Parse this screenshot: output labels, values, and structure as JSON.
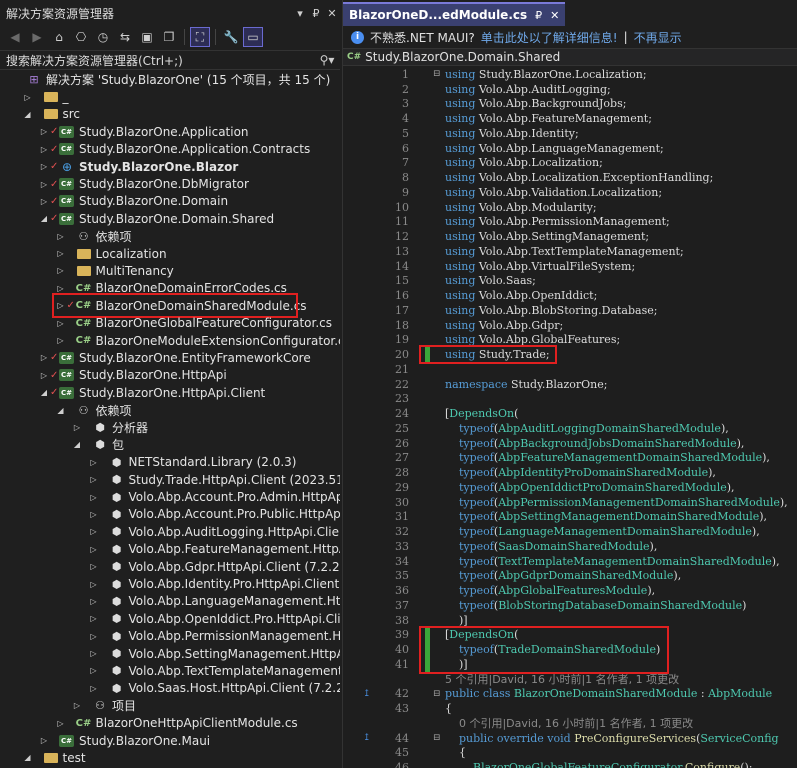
{
  "solution_explorer": {
    "title": "解决方案资源管理器",
    "title_controls": [
      "▾",
      "₽",
      "✕"
    ],
    "search_placeholder": "搜索解决方案资源管理器(Ctrl+;)",
    "tree": [
      {
        "label": "解决方案 'Study.BlazorOne' (15 个项目，共 15 个)",
        "icon": "sln",
        "indent": 0,
        "arrow": "",
        "check": false
      },
      {
        "label": "_",
        "icon": "folder",
        "indent": 1,
        "arrow": "▷",
        "check": false
      },
      {
        "label": "src",
        "icon": "folder",
        "indent": 1,
        "arrow": "◢",
        "check": false
      },
      {
        "label": "Study.BlazorOne.Application",
        "icon": "csproj",
        "indent": 2,
        "arrow": "▷",
        "check": true
      },
      {
        "label": "Study.BlazorOne.Application.Contracts",
        "icon": "csproj",
        "indent": 2,
        "arrow": "▷",
        "check": true
      },
      {
        "label": "Study.BlazorOne.Blazor",
        "icon": "web",
        "indent": 2,
        "arrow": "▷",
        "check": true,
        "bold": true
      },
      {
        "label": "Study.BlazorOne.DbMigrator",
        "icon": "csproj",
        "indent": 2,
        "arrow": "▷",
        "check": true
      },
      {
        "label": "Study.BlazorOne.Domain",
        "icon": "csproj",
        "indent": 2,
        "arrow": "▷",
        "check": true
      },
      {
        "label": "Study.BlazorOne.Domain.Shared",
        "icon": "csproj",
        "indent": 2,
        "arrow": "◢",
        "check": true
      },
      {
        "label": "依赖项",
        "icon": "deps",
        "indent": 3,
        "arrow": "▷",
        "check": false
      },
      {
        "label": "Localization",
        "icon": "folder",
        "indent": 3,
        "arrow": "▷",
        "check": false
      },
      {
        "label": "MultiTenancy",
        "icon": "folder",
        "indent": 3,
        "arrow": "▷",
        "check": false
      },
      {
        "label": "BlazorOneDomainErrorCodes.cs",
        "icon": "cs",
        "indent": 3,
        "arrow": "▷",
        "check": false
      },
      {
        "label": "BlazorOneDomainSharedModule.cs",
        "icon": "cs",
        "indent": 3,
        "arrow": "▷",
        "check": true,
        "highlight": true
      },
      {
        "label": "BlazorOneGlobalFeatureConfigurator.cs",
        "icon": "cs",
        "indent": 3,
        "arrow": "▷",
        "check": false
      },
      {
        "label": "BlazorOneModuleExtensionConfigurator.cs",
        "icon": "cs",
        "indent": 3,
        "arrow": "▷",
        "check": false
      },
      {
        "label": "Study.BlazorOne.EntityFrameworkCore",
        "icon": "csproj",
        "indent": 2,
        "arrow": "▷",
        "check": true
      },
      {
        "label": "Study.BlazorOne.HttpApi",
        "icon": "csproj",
        "indent": 2,
        "arrow": "▷",
        "check": true
      },
      {
        "label": "Study.BlazorOne.HttpApi.Client",
        "icon": "csproj",
        "indent": 2,
        "arrow": "◢",
        "check": true
      },
      {
        "label": "依赖项",
        "icon": "deps",
        "indent": 3,
        "arrow": "◢",
        "check": false
      },
      {
        "label": "分析器",
        "icon": "pkg",
        "indent": 4,
        "arrow": "▷",
        "check": false
      },
      {
        "label": "包",
        "icon": "pkg",
        "indent": 4,
        "arrow": "◢",
        "check": false
      },
      {
        "label": "NETStandard.Library (2.0.3)",
        "icon": "pkg",
        "indent": 5,
        "arrow": "▷",
        "check": false
      },
      {
        "label": "Study.Trade.HttpApi.Client (2023.51.11)",
        "icon": "pkg",
        "indent": 5,
        "arrow": "▷",
        "check": false
      },
      {
        "label": "Volo.Abp.Account.Pro.Admin.HttpApi.Client",
        "icon": "pkg",
        "indent": 5,
        "arrow": "▷",
        "check": false
      },
      {
        "label": "Volo.Abp.Account.Pro.Public.HttpApi.Client",
        "icon": "pkg",
        "indent": 5,
        "arrow": "▷",
        "check": false
      },
      {
        "label": "Volo.Abp.AuditLogging.HttpApi.Client (7.2",
        "icon": "pkg",
        "indent": 5,
        "arrow": "▷",
        "check": false
      },
      {
        "label": "Volo.Abp.FeatureManagement.HttpApi.Cli",
        "icon": "pkg",
        "indent": 5,
        "arrow": "▷",
        "check": false
      },
      {
        "label": "Volo.Abp.Gdpr.HttpApi.Client (7.2.2)",
        "icon": "pkg",
        "indent": 5,
        "arrow": "▷",
        "check": false
      },
      {
        "label": "Volo.Abp.Identity.Pro.HttpApi.Client (7.2.2",
        "icon": "pkg",
        "indent": 5,
        "arrow": "▷",
        "check": false
      },
      {
        "label": "Volo.Abp.LanguageManagement.HttpApi.",
        "icon": "pkg",
        "indent": 5,
        "arrow": "▷",
        "check": false
      },
      {
        "label": "Volo.Abp.OpenIddict.Pro.HttpApi.Client (7",
        "icon": "pkg",
        "indent": 5,
        "arrow": "▷",
        "check": false
      },
      {
        "label": "Volo.Abp.PermissionManagement.HttpApi",
        "icon": "pkg",
        "indent": 5,
        "arrow": "▷",
        "check": false
      },
      {
        "label": "Volo.Abp.SettingManagement.HttpApi.Cli",
        "icon": "pkg",
        "indent": 5,
        "arrow": "▷",
        "check": false
      },
      {
        "label": "Volo.Abp.TextTemplateManagement.Http.",
        "icon": "pkg",
        "indent": 5,
        "arrow": "▷",
        "check": false
      },
      {
        "label": "Volo.Saas.Host.HttpApi.Client (7.2.2)",
        "icon": "pkg",
        "indent": 5,
        "arrow": "▷",
        "check": false
      },
      {
        "label": "项目",
        "icon": "deps",
        "indent": 4,
        "arrow": "▷",
        "check": false
      },
      {
        "label": "BlazorOneHttpApiClientModule.cs",
        "icon": "cs",
        "indent": 3,
        "arrow": "▷",
        "check": false
      },
      {
        "label": "Study.BlazorOne.Maui",
        "icon": "csproj",
        "indent": 2,
        "arrow": "▷",
        "check": false
      },
      {
        "label": "test",
        "icon": "folder",
        "indent": 1,
        "arrow": "◢",
        "check": false
      }
    ]
  },
  "editor": {
    "tab_label": "BlazorOneD...edModule.cs",
    "tab_pin": "₽",
    "tab_close": "✕",
    "info_text": "不熟悉.NET MAUI?",
    "info_link": "单击此处以了解详细信息!",
    "info_separator": "|",
    "info_dismiss": "不再显示",
    "nav_project": "Study.BlazorOne.Domain.Shared",
    "lines": [
      {
        "n": "1",
        "t": "using Study.BlazorOne.Localization;",
        "kind": "using"
      },
      {
        "n": "2",
        "t": "using Volo.Abp.AuditLogging;",
        "kind": "using"
      },
      {
        "n": "3",
        "t": "using Volo.Abp.BackgroundJobs;",
        "kind": "using"
      },
      {
        "n": "4",
        "t": "using Volo.Abp.FeatureManagement;",
        "kind": "using"
      },
      {
        "n": "5",
        "t": "using Volo.Abp.Identity;",
        "kind": "using"
      },
      {
        "n": "6",
        "t": "using Volo.Abp.LanguageManagement;",
        "kind": "using"
      },
      {
        "n": "7",
        "t": "using Volo.Abp.Localization;",
        "kind": "using"
      },
      {
        "n": "8",
        "t": "using Volo.Abp.Localization.ExceptionHandling;",
        "kind": "using"
      },
      {
        "n": "9",
        "t": "using Volo.Abp.Validation.Localization;",
        "kind": "using"
      },
      {
        "n": "10",
        "t": "using Volo.Abp.Modularity;",
        "kind": "using"
      },
      {
        "n": "11",
        "t": "using Volo.Abp.PermissionManagement;",
        "kind": "using"
      },
      {
        "n": "12",
        "t": "using Volo.Abp.SettingManagement;",
        "kind": "using"
      },
      {
        "n": "13",
        "t": "using Volo.Abp.TextTemplateManagement;",
        "kind": "using"
      },
      {
        "n": "14",
        "t": "using Volo.Abp.VirtualFileSystem;",
        "kind": "using"
      },
      {
        "n": "15",
        "t": "using Volo.Saas;",
        "kind": "using"
      },
      {
        "n": "16",
        "t": "using Volo.Abp.OpenIddict;",
        "kind": "using"
      },
      {
        "n": "17",
        "t": "using Volo.Abp.BlobStoring.Database;",
        "kind": "using"
      },
      {
        "n": "18",
        "t": "using Volo.Abp.Gdpr;",
        "kind": "using"
      },
      {
        "n": "19",
        "t": "using Volo.Abp.GlobalFeatures;",
        "kind": "using"
      },
      {
        "n": "20",
        "t": "using Study.Trade;",
        "kind": "using",
        "green": true
      },
      {
        "n": "21",
        "t": "",
        "kind": "blank"
      },
      {
        "n": "22",
        "t": "namespace Study.BlazorOne;",
        "kind": "namespace"
      },
      {
        "n": "23",
        "t": "",
        "kind": "blank"
      },
      {
        "n": "24",
        "t": "[DependsOn(",
        "kind": "attr"
      },
      {
        "n": "25",
        "t": "    typeof(AbpAuditLoggingDomainSharedModule),",
        "kind": "typeof"
      },
      {
        "n": "26",
        "t": "    typeof(AbpBackgroundJobsDomainSharedModule),",
        "kind": "typeof"
      },
      {
        "n": "27",
        "t": "    typeof(AbpFeatureManagementDomainSharedModule),",
        "kind": "typeof"
      },
      {
        "n": "28",
        "t": "    typeof(AbpIdentityProDomainSharedModule),",
        "kind": "typeof"
      },
      {
        "n": "29",
        "t": "    typeof(AbpOpenIddictProDomainSharedModule),",
        "kind": "typeof"
      },
      {
        "n": "30",
        "t": "    typeof(AbpPermissionManagementDomainSharedModule),",
        "kind": "typeof"
      },
      {
        "n": "31",
        "t": "    typeof(AbpSettingManagementDomainSharedModule),",
        "kind": "typeof"
      },
      {
        "n": "32",
        "t": "    typeof(LanguageManagementDomainSharedModule),",
        "kind": "typeof"
      },
      {
        "n": "33",
        "t": "    typeof(SaasDomainSharedModule),",
        "kind": "typeof"
      },
      {
        "n": "34",
        "t": "    typeof(TextTemplateManagementDomainSharedModule),",
        "kind": "typeof"
      },
      {
        "n": "35",
        "t": "    typeof(AbpGdprDomainSharedModule),",
        "kind": "typeof"
      },
      {
        "n": "36",
        "t": "    typeof(AbpGlobalFeaturesModule),",
        "kind": "typeof"
      },
      {
        "n": "37",
        "t": "    typeof(BlobStoringDatabaseDomainSharedModule)",
        "kind": "typeof"
      },
      {
        "n": "38",
        "t": "    )]",
        "kind": "plain"
      },
      {
        "n": "39",
        "t": "[DependsOn(",
        "kind": "attr",
        "green": true
      },
      {
        "n": "40",
        "t": "    typeof(TradeDomainSharedModule)",
        "kind": "typeof",
        "green": true
      },
      {
        "n": "41",
        "t": "    )]",
        "kind": "plain",
        "green": true
      },
      {
        "n": "",
        "t": "5 个引用|David, 16 小时前|1 名作者, 1 项更改",
        "kind": "lens"
      },
      {
        "n": "42",
        "t": "public class BlazorOneDomainSharedModule : AbpModule",
        "kind": "class",
        "ref": true
      },
      {
        "n": "43",
        "t": "{",
        "kind": "plain"
      },
      {
        "n": "",
        "t": "    0 个引用|David, 16 小时前|1 名作者, 1 项更改",
        "kind": "lens"
      },
      {
        "n": "44",
        "t": "    public override void PreConfigureServices(ServiceConfig",
        "kind": "method",
        "ref": true
      },
      {
        "n": "45",
        "t": "    {",
        "kind": "plain"
      },
      {
        "n": "46",
        "t": "        BlazorOneGlobalFeatureConfigurator.Configure();",
        "kind": "call"
      }
    ]
  }
}
